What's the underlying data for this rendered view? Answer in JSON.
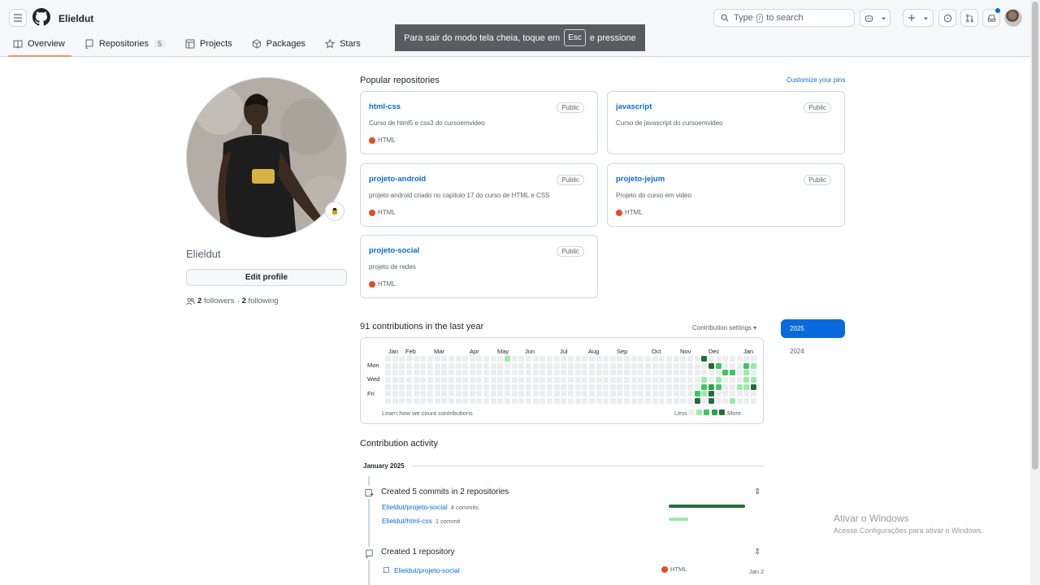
{
  "header": {
    "username": "Elieldut",
    "search_placeholder_pre": "Type",
    "search_key": "/",
    "search_placeholder_post": "to search"
  },
  "tabs": [
    {
      "label": "Overview"
    },
    {
      "label": "Repositories",
      "count": "5"
    },
    {
      "label": "Projects"
    },
    {
      "label": "Packages"
    },
    {
      "label": "Stars"
    }
  ],
  "toast": {
    "pre": "Para sair do modo tela cheia, toque em",
    "key": "Esc",
    "post": "e pressione"
  },
  "profile": {
    "name": "Elieldut",
    "edit_label": "Edit profile",
    "followers_count": "2",
    "followers_label": "followers",
    "sep": "·",
    "following_count": "2",
    "following_label": "following"
  },
  "popular": {
    "title": "Popular repositories",
    "customize": "Customize your pins",
    "repos": [
      {
        "name": "html-css",
        "badge": "Public",
        "desc": "Curso de html5 e css3 do cursoemvideo",
        "lang": "HTML"
      },
      {
        "name": "javascript",
        "badge": "Public",
        "desc": "Curso de javascript do cursoemvideo",
        "lang": ""
      },
      {
        "name": "projeto-android",
        "badge": "Public",
        "desc": "projeto android criado no capitulo 17 do curso de HTML e CSS",
        "lang": "HTML"
      },
      {
        "name": "projeto-jejum",
        "badge": "Public",
        "desc": "Projeto do curso em video",
        "lang": "HTML"
      },
      {
        "name": "projeto-social",
        "badge": "Public",
        "desc": "projeto de redes",
        "lang": "HTML"
      }
    ]
  },
  "contributions": {
    "title": "91 contributions in the last year",
    "settings": "Contribution settings",
    "months": [
      "Jan",
      "Feb",
      "Mar",
      "Apr",
      "May",
      "Jun",
      "Jul",
      "Aug",
      "Sep",
      "Oct",
      "Nov",
      "Dec",
      "Jan"
    ],
    "days": [
      "Mon",
      "Wed",
      "Fri"
    ],
    "learn": "Learn how we count contributions",
    "less": "Less",
    "more": "More",
    "colors": [
      "#ebedf0",
      "#9be9a8",
      "#40c463",
      "#30a14e",
      "#216e39"
    ]
  },
  "years": [
    "2025",
    "2024"
  ],
  "activity": {
    "title": "Contribution activity",
    "month": "January 2025",
    "commits_head": "Created 5 commits in 2 repositories",
    "commit_repos": [
      {
        "repo": "Elieldut/projeto-social",
        "count": "4 commits"
      },
      {
        "repo": "Elieldut/html-css",
        "count": "1 commit"
      }
    ],
    "repo_head": "Created 1 repository",
    "new_repo": {
      "repo": "Elieldut/projeto-social",
      "lang": "HTML",
      "date": "Jan 2"
    }
  },
  "watermark": {
    "line1": "Ativar o Windows",
    "line2": "Acesse Configurações para ativar o Windows."
  }
}
